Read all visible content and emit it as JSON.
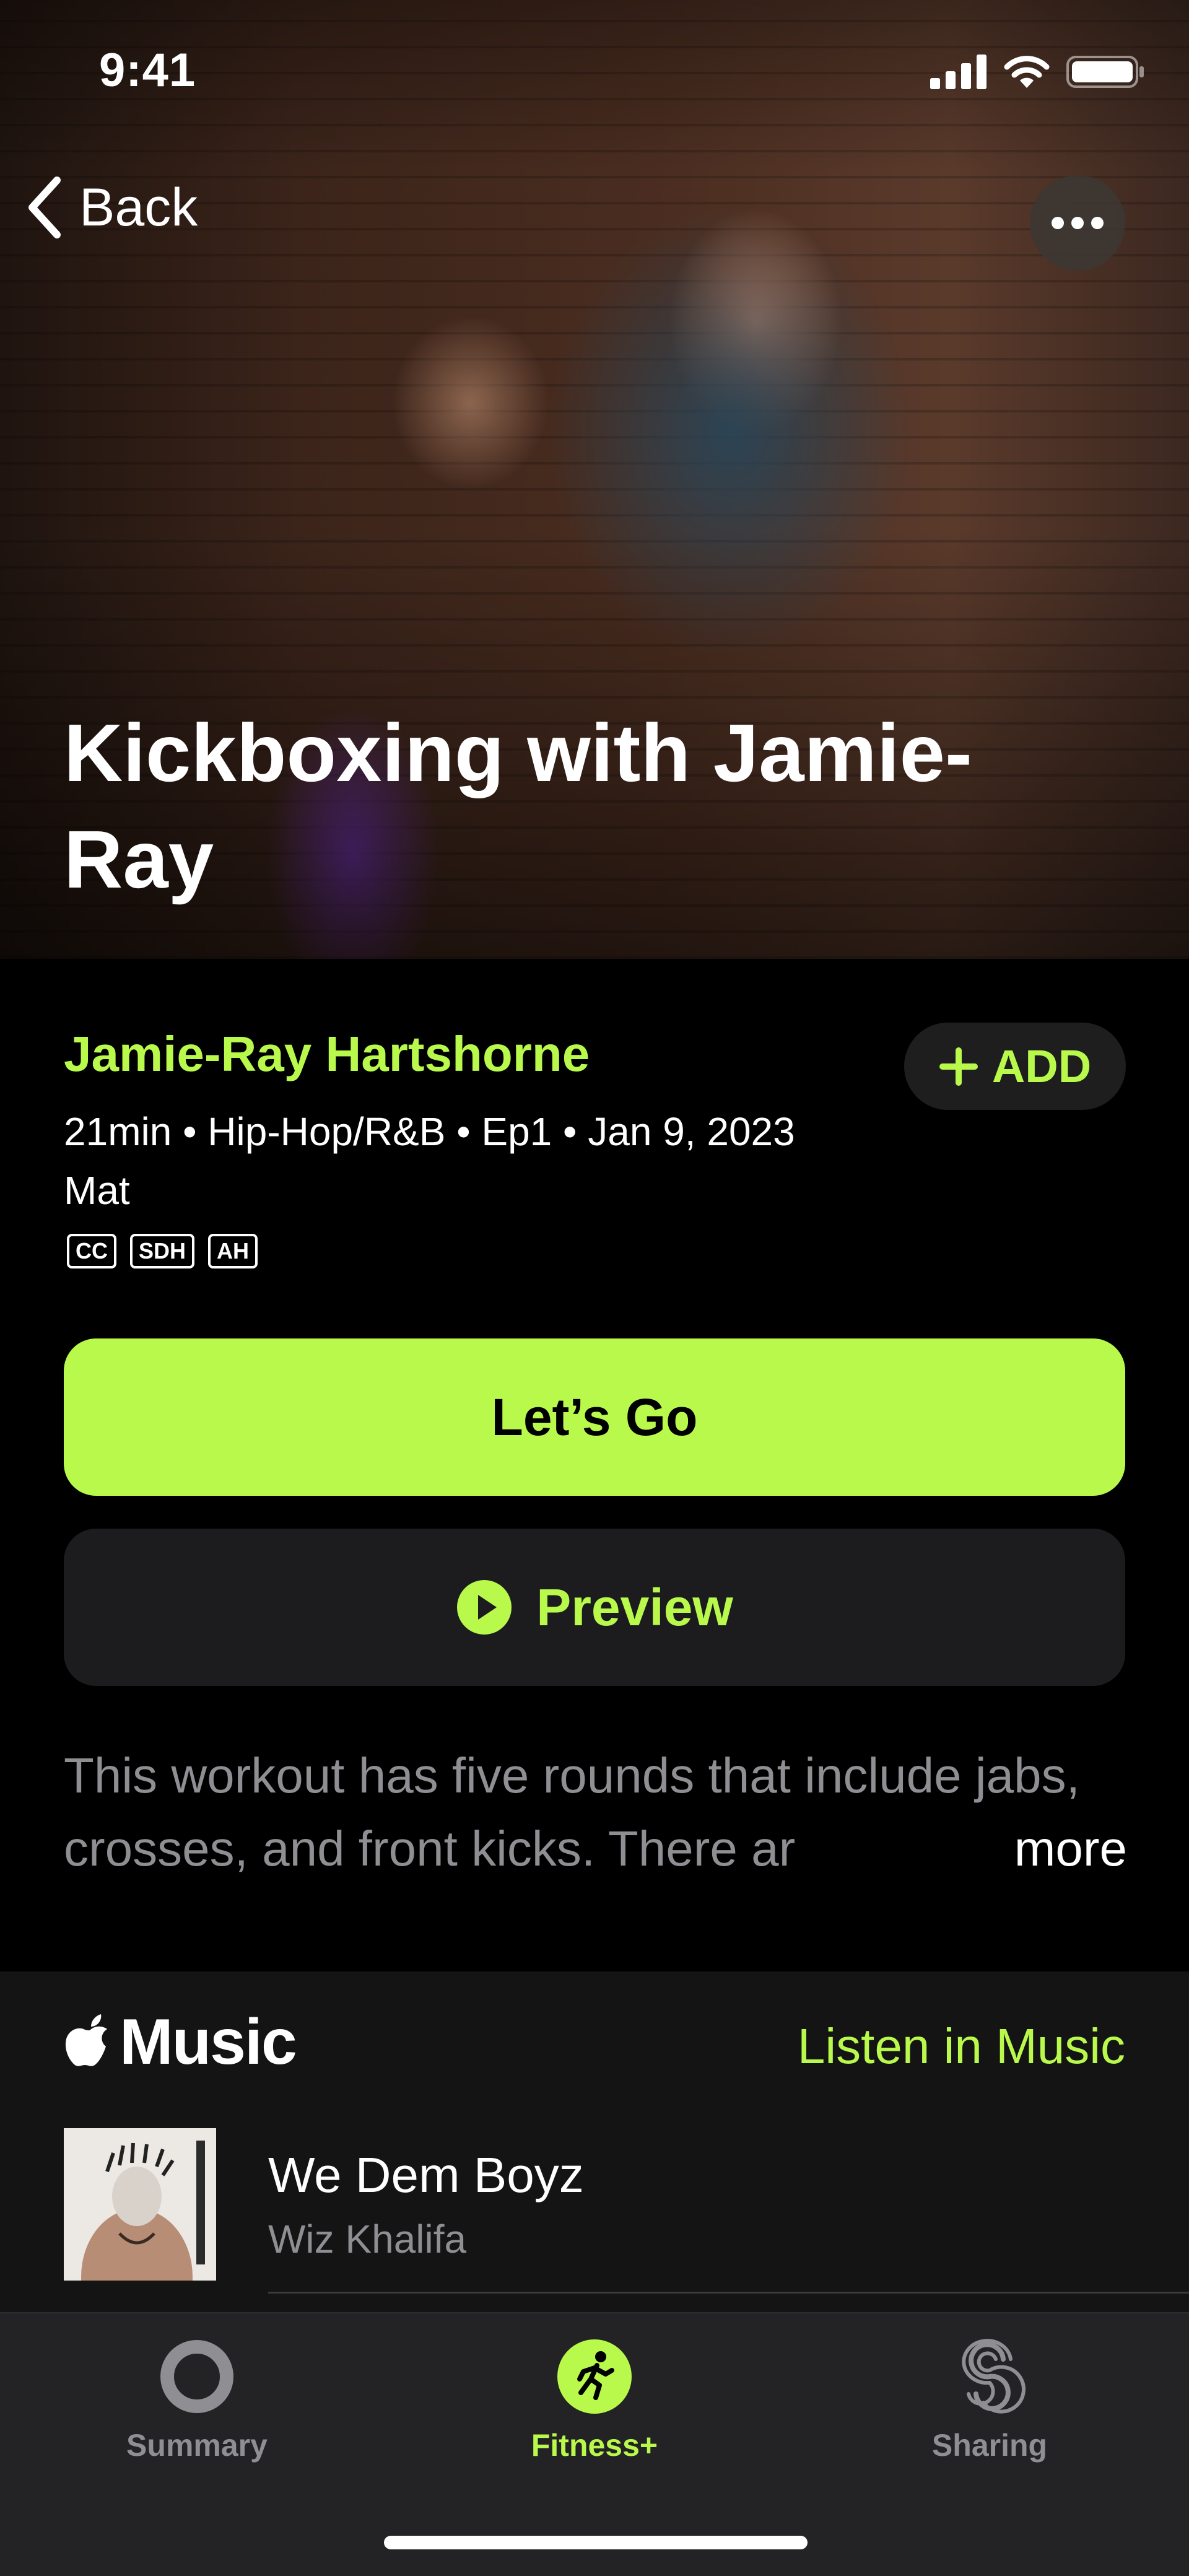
{
  "status_bar": {
    "time": "9:41"
  },
  "nav": {
    "back_label": "Back"
  },
  "hero": {
    "title": "Kickboxing with Jamie-Ray"
  },
  "workout": {
    "instructor": "Jamie-Ray Hartshorne",
    "add_label": "ADD",
    "meta": "21min • Hip-Hop/R&B • Ep1 • Jan 9, 2023",
    "equipment": "Mat",
    "badges": [
      "CC",
      "SDH",
      "AH"
    ],
    "lets_go_label": "Let’s Go",
    "preview_label": "Preview",
    "description": "This workout has five rounds that include jabs, crosses, and front kicks. There ar",
    "more_label": "more"
  },
  "music": {
    "brand": "Music",
    "listen_label": "Listen in Music",
    "tracks": [
      {
        "title": "We Dem Boyz",
        "artist": "Wiz Khalifa"
      }
    ]
  },
  "tab_bar": {
    "tabs": [
      {
        "label": "Summary",
        "icon": "activity-ring-icon",
        "active": false
      },
      {
        "label": "Fitness+",
        "icon": "runner-icon",
        "active": true
      },
      {
        "label": "Sharing",
        "icon": "sharing-icon",
        "active": false
      }
    ]
  },
  "colors": {
    "accent": "#b9f94c",
    "background": "#000000",
    "secondary_text": "#8e8e93",
    "card": "#1c1c1e"
  }
}
